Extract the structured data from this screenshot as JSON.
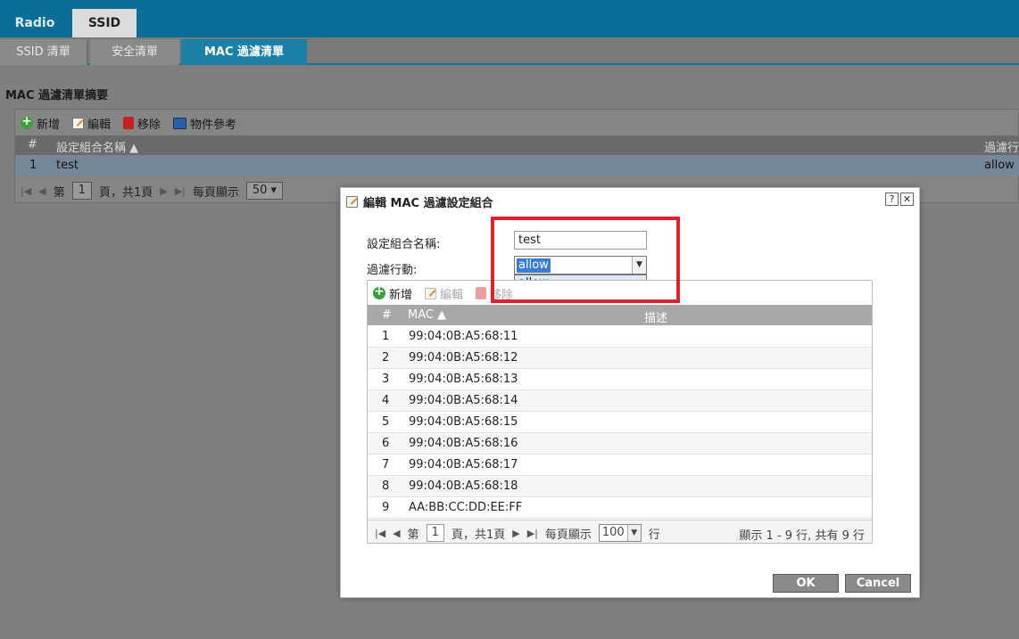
{
  "top_tabs": [
    "Radio",
    "SSID"
  ],
  "sub_tabs": [
    "SSID 清單",
    "安全清單",
    "MAC 過濾清單"
  ],
  "summary": {
    "title": "MAC 過濾清單摘要",
    "toolbar": {
      "add": "新增",
      "edit": "編輯",
      "remove": "移除",
      "ref": "物件參考"
    },
    "columns": {
      "num": "#",
      "name": "設定組合名稱 ▲",
      "action": "過濾行"
    },
    "rows": [
      {
        "num": "1",
        "name": "test",
        "action": "allow"
      }
    ],
    "pager": {
      "page_prefix": "第",
      "page": "1",
      "page_suffix": "頁，共1頁",
      "per_page_label": "每頁顯示",
      "per_page": "50"
    }
  },
  "dialog": {
    "title": "編輯 MAC 過濾設定組合",
    "help": "?",
    "close": "✕",
    "name_label": "設定組合名稱:",
    "name_value": "test",
    "action_label": "過濾行動:",
    "action_value": "allow",
    "action_options": [
      "allow"
    ],
    "toolbar": {
      "add": "新增",
      "edit": "編輯",
      "remove": "移除"
    },
    "columns": {
      "num": "#",
      "mac": "MAC ▲",
      "desc": "描述"
    },
    "rows": [
      {
        "num": "1",
        "mac": "99:04:0B:A5:68:11"
      },
      {
        "num": "2",
        "mac": "99:04:0B:A5:68:12"
      },
      {
        "num": "3",
        "mac": "99:04:0B:A5:68:13"
      },
      {
        "num": "4",
        "mac": "99:04:0B:A5:68:14"
      },
      {
        "num": "5",
        "mac": "99:04:0B:A5:68:15"
      },
      {
        "num": "6",
        "mac": "99:04:0B:A5:68:16"
      },
      {
        "num": "7",
        "mac": "99:04:0B:A5:68:17"
      },
      {
        "num": "8",
        "mac": "99:04:0B:A5:68:18"
      },
      {
        "num": "9",
        "mac": "AA:BB:CC:DD:EE:FF"
      }
    ],
    "pager": {
      "page_prefix": "第",
      "page": "1",
      "page_suffix": "頁，共1頁",
      "per_page_label": "每頁顯示",
      "per_page": "100",
      "rows_unit": "行",
      "info": "顯示 1 - 9 行, 共有 9 行"
    },
    "ok": "OK",
    "cancel": "Cancel"
  },
  "colors": {
    "accent": "#0a6f98",
    "highlight": "#e0202a",
    "selected": "#3a7bd5"
  }
}
